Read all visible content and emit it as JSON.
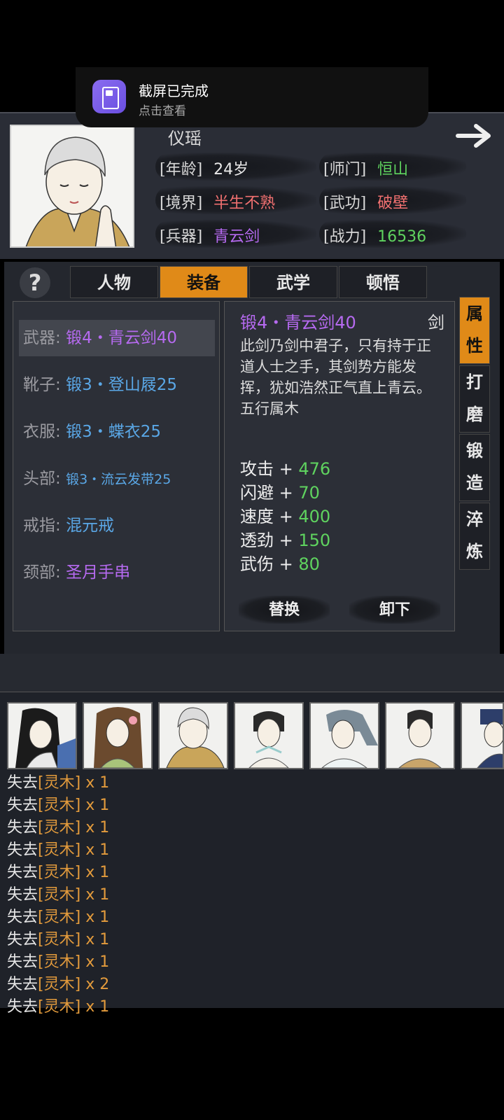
{
  "notification": {
    "title": "截屏已完成",
    "subtitle": "点击查看"
  },
  "character": {
    "name": "仪瑶",
    "stats": [
      {
        "label": "[年龄]",
        "value": "24岁",
        "color": "#e8e8e8"
      },
      {
        "label": "[师门]",
        "value": "恒山",
        "color": "#5fd35f"
      },
      {
        "label": "[境界]",
        "value": "半生不熟",
        "color": "#f07070"
      },
      {
        "label": "[武功]",
        "value": "破壁",
        "color": "#f07070"
      },
      {
        "label": "[兵器]",
        "value": "青云剑",
        "color": "#b66af0"
      },
      {
        "label": "[战力]",
        "value": "16536",
        "color": "#5fd35f"
      }
    ]
  },
  "help_icon": "question-mark-icon",
  "tabs": [
    "人物",
    "装备",
    "武学",
    "顿悟"
  ],
  "active_tab": "装备",
  "slots": [
    {
      "label": "武器:",
      "value": "锻4・青云剑40",
      "color": "purple",
      "selected": true
    },
    {
      "label": "靴子:",
      "value": "锻3・登山屐25",
      "color": "blue"
    },
    {
      "label": "衣服:",
      "value": "锻3・蝶衣25",
      "color": "blue"
    },
    {
      "label": "头部:",
      "value": "锻3・流云发带25",
      "color": "blue"
    },
    {
      "label": "戒指:",
      "value": "混元戒",
      "color": "blue"
    },
    {
      "label": "颈部:",
      "value": "圣月手串",
      "color": "purple"
    }
  ],
  "detail": {
    "title": "锻4・青云剑40",
    "type": "剑",
    "description": "此剑乃剑中君子，只有持于正道人士之手，其剑势方能发挥，犹如浩然正气直上青云。",
    "element": "五行属木",
    "stats": [
      {
        "name": "攻击",
        "value": "476"
      },
      {
        "name": "闪避",
        "value": "70"
      },
      {
        "name": "速度",
        "value": "400"
      },
      {
        "name": "透劲",
        "value": "150"
      },
      {
        "name": "武伤",
        "value": "80"
      }
    ],
    "replace_label": "替换",
    "unequip_label": "卸下"
  },
  "side_tabs": [
    "属性",
    "打磨",
    "锻造",
    "淬炼"
  ],
  "active_side_tab": "属性",
  "party": [
    "character-portrait-1",
    "character-portrait-2",
    "character-portrait-3",
    "character-portrait-4",
    "character-portrait-5",
    "character-portrait-6",
    "character-portrait-7"
  ],
  "log": {
    "prefix": "失去",
    "item": "[灵木]",
    "lines": [
      "x 1",
      "x 1",
      "x 1",
      "x 1",
      "x 1",
      "x 1",
      "x 1",
      "x 1",
      "x 1",
      "x 2",
      "x 1"
    ]
  }
}
